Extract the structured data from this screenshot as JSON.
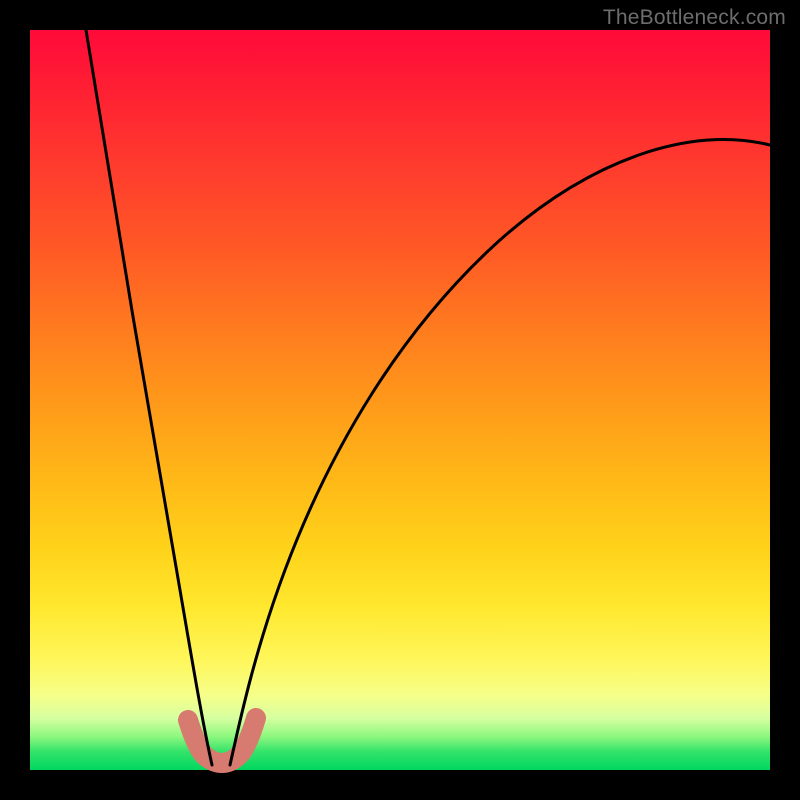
{
  "watermark": "TheBottleneck.com",
  "chart_data": {
    "type": "line",
    "title": "",
    "xlabel": "",
    "ylabel": "",
    "xlim": [
      0,
      100
    ],
    "ylim": [
      0,
      100
    ],
    "grid": false,
    "legend": false,
    "series": [
      {
        "name": "left-branch",
        "x": [
          8,
          10,
          12,
          14,
          16,
          18,
          20,
          21.5,
          22.5,
          23.2,
          23.8
        ],
        "y": [
          100,
          84,
          68,
          53,
          39,
          26,
          14,
          7,
          3,
          1,
          0.2
        ]
      },
      {
        "name": "right-branch",
        "x": [
          27.5,
          28.2,
          29.2,
          31,
          34,
          38,
          44,
          52,
          62,
          74,
          88,
          100
        ],
        "y": [
          0.2,
          2,
          6,
          12,
          21,
          31,
          42,
          53,
          63,
          72,
          79,
          84
        ]
      },
      {
        "name": "bottom-bump",
        "x": [
          22.4,
          23.0,
          23.8,
          24.6,
          25.5,
          26.4,
          27.2,
          28.0,
          28.6
        ],
        "y": [
          6.5,
          3.2,
          1.4,
          0.7,
          0.6,
          0.8,
          1.8,
          3.8,
          7.0
        ]
      }
    ],
    "colors": {
      "curve": "#000000",
      "bump": "#d77a6f"
    }
  }
}
